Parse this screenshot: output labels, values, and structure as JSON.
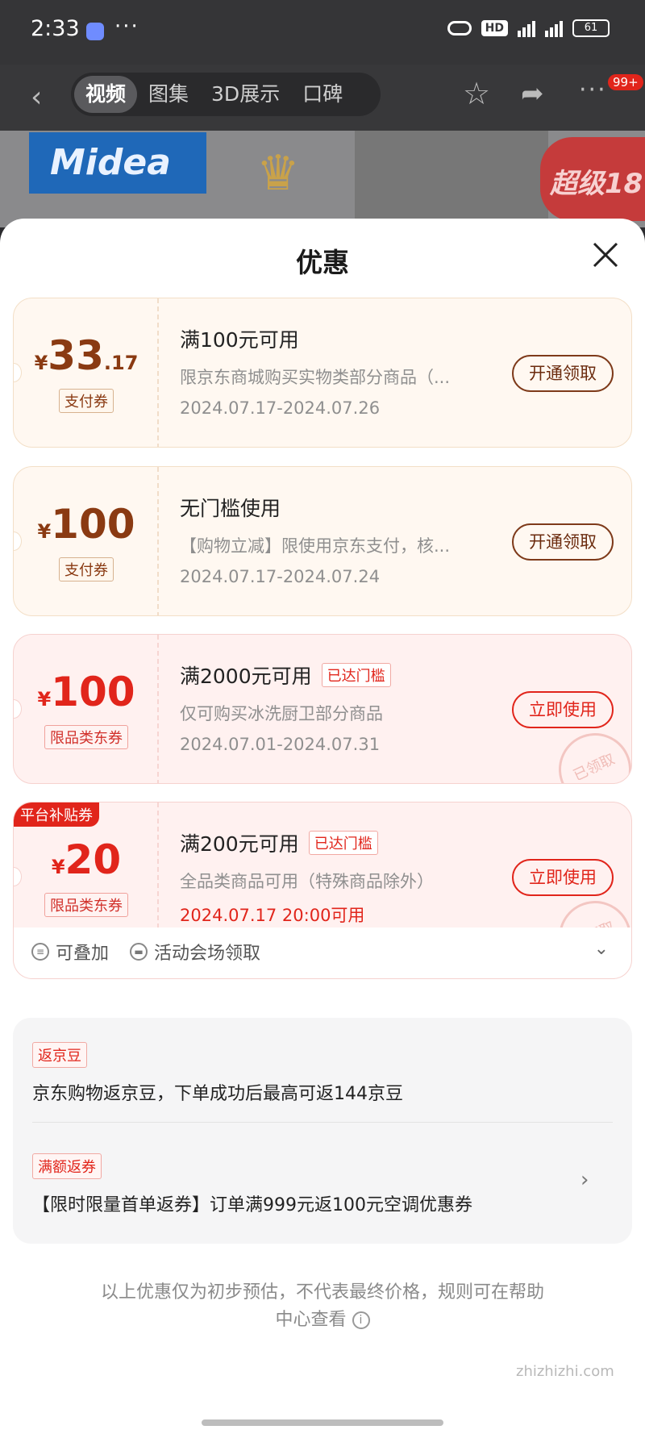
{
  "status_bar": {
    "time": "2:33",
    "dots": "···",
    "hd_label": "HD",
    "battery": "61"
  },
  "nav": {
    "tabs": [
      {
        "label": "视频",
        "active": true
      },
      {
        "label": "图集",
        "active": false
      },
      {
        "label": "3D展示",
        "active": false
      },
      {
        "label": "口碑",
        "active": false
      }
    ],
    "badge": "99+"
  },
  "hero": {
    "brand": "Midea",
    "promo_tag": "超级18"
  },
  "sheet": {
    "title": "优惠"
  },
  "coupons": [
    {
      "yen": "¥",
      "amount": "33",
      "decimal": ".17",
      "type": "支付券",
      "title": "满100元可用",
      "desc": "限京东商城购买实物类部分商品（...",
      "date": "2024.07.17-2024.07.26",
      "button": "开通领取"
    },
    {
      "yen": "¥",
      "amount": "100",
      "decimal": "",
      "type": "支付券",
      "title": "无门槛使用",
      "desc": "【购物立减】限使用京东支付，核...",
      "date": "2024.07.17-2024.07.24",
      "button": "开通领取"
    },
    {
      "yen": "¥",
      "amount": "100",
      "decimal": "",
      "type": "限品类东券",
      "title": "满2000元可用",
      "badge": "已达门槛",
      "desc": "仅可购买冰洗厨卫部分商品",
      "date": "2024.07.01-2024.07.31",
      "button": "立即使用",
      "stamp": "已领取"
    },
    {
      "corner_tag": "平台补贴券",
      "yen": "¥",
      "amount": "20",
      "decimal": "",
      "type": "限品类东券",
      "title": "满200元可用",
      "badge": "已达门槛",
      "desc": "全品类商品可用（特殊商品除外）",
      "date": "2024.07.17 20:00可用",
      "button": "立即使用",
      "stamp": "已领取"
    }
  ],
  "coupon_footer": {
    "stackable": "可叠加",
    "source": "活动会场领取"
  },
  "rebates": [
    {
      "tag": "返京豆",
      "text": "京东购物返京豆，下单成功后最高可返144京豆"
    },
    {
      "tag": "满额返券",
      "text": "【限时限量首单返券】订单满999元返100元空调优惠券"
    }
  ],
  "disclaimer": {
    "line1": "以上优惠仅为初步预估，不代表最终价格，规则可在帮助",
    "line2": "中心查看"
  },
  "watermark": "zhizhizhi.com",
  "colors": {
    "accent_red": "#e1251b",
    "coupon_brown": "#8a3a12",
    "coupon_bg_cream": "#fff8f1",
    "coupon_bg_red": "#fff1f0"
  }
}
